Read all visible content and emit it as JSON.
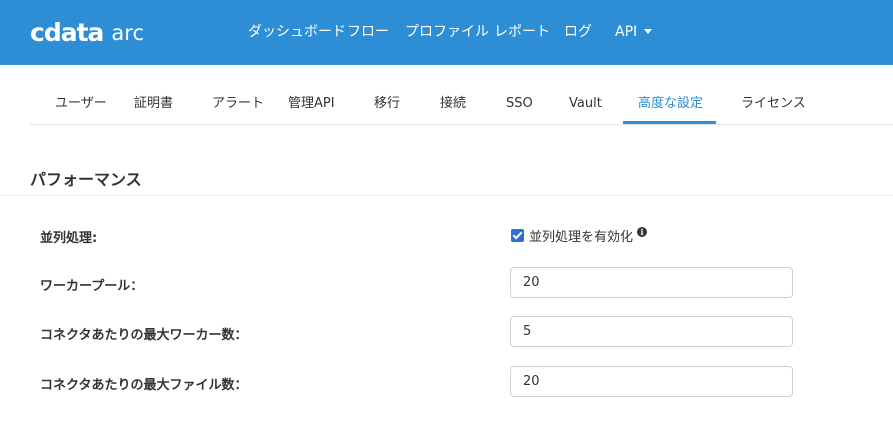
{
  "app": {
    "brand": "cdata",
    "product": "arc"
  },
  "nav": {
    "items": [
      "ダッシュボード",
      "フロー",
      "プロファイル",
      "レポート",
      "ログ",
      "API"
    ]
  },
  "tabs": {
    "items": [
      "ユーザー",
      "証明書",
      "アラート",
      "管理API",
      "移行",
      "接続",
      "SSO",
      "Vault",
      "高度な設定",
      "ライセンス"
    ],
    "active": "高度な設定"
  },
  "section": {
    "title": "パフォーマンス"
  },
  "settings": {
    "parallel": {
      "label": "並列処理:",
      "checkbox_label": "並列処理を有効化",
      "checked": true
    },
    "worker_pool": {
      "label": "ワーカープール：",
      "value": "20"
    },
    "max_workers": {
      "label": "コネクタあたりの最大ワーカー数：",
      "value": "5"
    },
    "max_files": {
      "label": "コネクタあたりの最大ファイル数：",
      "value": "20"
    }
  },
  "colors": {
    "accent": "#2d8ed6",
    "header_bg": "#2d8ed6",
    "checkbox": "#2d6fd6"
  },
  "icons": {
    "info": "info-icon",
    "dropdown": "caret-down-icon"
  }
}
